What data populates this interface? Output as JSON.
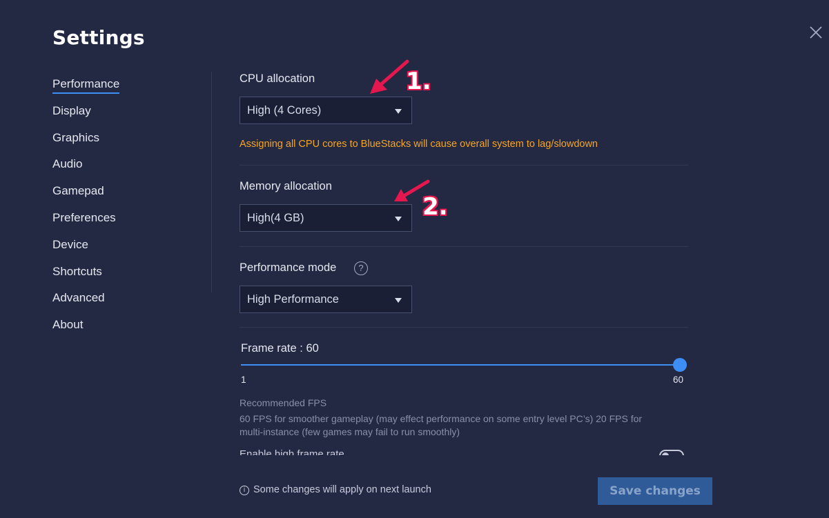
{
  "window": {
    "title": "Settings"
  },
  "sidebar": {
    "items": [
      {
        "label": "Performance"
      },
      {
        "label": "Display"
      },
      {
        "label": "Graphics"
      },
      {
        "label": "Audio"
      },
      {
        "label": "Gamepad"
      },
      {
        "label": "Preferences"
      },
      {
        "label": "Device"
      },
      {
        "label": "Shortcuts"
      },
      {
        "label": "Advanced"
      },
      {
        "label": "About"
      }
    ],
    "active": "Performance"
  },
  "cpu": {
    "label": "CPU allocation",
    "value": "High (4 Cores)",
    "warning": "Assigning all CPU cores to BlueStacks will cause overall system to lag/slowdown"
  },
  "memory": {
    "label": "Memory allocation",
    "value": "High(4 GB)"
  },
  "performance_mode": {
    "label": "Performance mode",
    "value": "High Performance",
    "help_icon": "?"
  },
  "frame_rate": {
    "label": "Frame rate : 60",
    "value": 60,
    "min": 1,
    "max": 60,
    "min_label": "1",
    "max_label": "60"
  },
  "recommended": {
    "title": "Recommended FPS",
    "line1": "60 FPS for smoother gameplay (may effect performance on some entry level PC’s) 20 FPS for",
    "line2": "multi-instance (few games may fail to run smoothly)"
  },
  "high_frame_rate": {
    "label": "Enable high frame rate",
    "enabled": false
  },
  "footer": {
    "info_icon": "i",
    "note": "Some changes will apply on next launch",
    "save_label": "Save changes"
  },
  "annotations": {
    "first": "1.",
    "second": "2."
  },
  "colors": {
    "background": "#232843",
    "accent": "#3d8ef5",
    "warning": "#f5a623",
    "annotation": "#e4184e",
    "save_button": "#2f5b98"
  },
  "icons": {
    "close": "close-icon",
    "dropdown": "chevron-down-icon",
    "help": "help-circle-icon",
    "info": "info-icon"
  }
}
